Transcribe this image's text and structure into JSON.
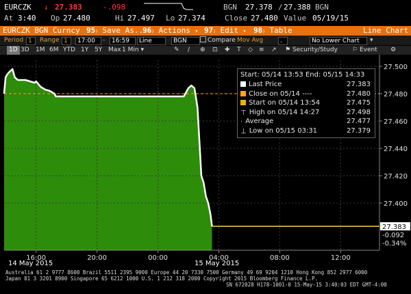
{
  "quote": {
    "ticker": "EURCZK",
    "arrow": "↓",
    "last": "27.383",
    "change": "-.098",
    "bid_label": "BGN",
    "bid": "27.378",
    "ask": "27.388",
    "ask_label": "BGN",
    "time_label": "At",
    "time": "3:40",
    "open_label": "Op",
    "open": "27.480",
    "high_label": "Hi",
    "high": "27.497",
    "low_label": "Lo",
    "low": "27.374",
    "close_label": "Close",
    "close": "27.480",
    "value_label": "Value",
    "value_date": "05/19/15"
  },
  "menu": {
    "security": "EURCZK BGN Curncy",
    "save_num": "95",
    "save": "Save As...",
    "actions_num": "96",
    "actions": "Actions",
    "edit_num": "97",
    "edit": "Edit",
    "table_num": "98",
    "table": "Table",
    "chart_title": "Line Chart"
  },
  "toolbar": {
    "period_label": "Period",
    "period_value": "1",
    "range_label": "Range",
    "range_value": "1",
    "start_time": "17:00",
    "end_time": "16:59",
    "line_select": "Line",
    "source": "BGN",
    "compare": "Compare",
    "mov_avg": "Mov Avg",
    "lower_chart": "No Lower Chart"
  },
  "ranges": {
    "items": [
      "1D",
      "3D",
      "1M",
      "6M",
      "YTD",
      "1Y",
      "5Y",
      "Max"
    ],
    "selected": "1D",
    "interval": "1 Min",
    "security_study": "Security/Study",
    "event": "Event"
  },
  "legend": {
    "header": "Start: 05/14 13:53 End: 05/15 14:33",
    "rows": [
      {
        "label": "Last Price",
        "value": "27.383",
        "marker": "white-box"
      },
      {
        "label": "Close on 05/14 ----",
        "value": "27.480",
        "marker": "orange-box"
      },
      {
        "label": "Start on 05/14 13:54",
        "value": "27.475",
        "marker": "gold-box"
      },
      {
        "label": "High on 05/14 14:27",
        "value": "27.498",
        "marker": "high-marker"
      },
      {
        "label": "Average",
        "value": "27.477",
        "marker": "average-marker"
      },
      {
        "label": "Low on 05/15 03:31",
        "value": "27.379",
        "marker": "low-marker"
      }
    ]
  },
  "last_tag": {
    "price": "27.383",
    "change": "-0.092",
    "pct": "-0.34%"
  },
  "date_labels": [
    "14 May 2015",
    "15 May 2015"
  ],
  "footer": {
    "line1": "Australia 61 2 9777 8600 Brazil 5511 2395 9000 Europe 44 20 7330 7500 Germany 49 69 9204 1210 Hong Kong 852 2977 6000",
    "line2": "Japan 81 3 3201 8900        Singapore 65 6212 1000        U.S. 1 212 318 2000        Copyright 2015 Bloomberg Finance L.P.",
    "line3": "SN 672028 H178-1001-0 15-May-15  3:40:03 EDT  GMT-4:00"
  },
  "colors": {
    "area_fill": "#2e8c0b",
    "line": "#ffffff",
    "close_line": "#ffa31a",
    "last_line": "#ffd24d",
    "menu_bar": "#e8700f",
    "down": "#ff3b3b"
  },
  "chart_data": {
    "type": "area",
    "title": "",
    "xlabel": "",
    "ylabel": "",
    "ylim": [
      27.38,
      27.5
    ],
    "y_ticks": [
      "27.500",
      "27.480",
      "27.460",
      "27.440",
      "27.420",
      "27.400"
    ],
    "x_ticks": [
      "16:00",
      "20:00",
      "00:00",
      "04:00",
      "08:00",
      "12:00"
    ],
    "x_tick_hours": [
      16,
      20,
      24,
      28,
      32,
      36
    ],
    "x_range_hours": [
      13.9,
      38.55
    ],
    "grid": true,
    "series": [
      {
        "name": "Last Price",
        "points": [
          [
            13.9,
            27.48
          ],
          [
            14.0,
            27.492
          ],
          [
            14.1,
            27.494
          ],
          [
            14.25,
            27.496
          ],
          [
            14.45,
            27.498
          ],
          [
            14.6,
            27.492
          ],
          [
            14.8,
            27.49
          ],
          [
            15.0,
            27.49
          ],
          [
            15.3,
            27.49
          ],
          [
            15.6,
            27.489
          ],
          [
            15.9,
            27.488
          ],
          [
            16.0,
            27.489
          ],
          [
            16.3,
            27.485
          ],
          [
            16.6,
            27.483
          ],
          [
            16.9,
            27.482
          ],
          [
            17.2,
            27.48
          ],
          [
            17.3,
            27.478
          ],
          [
            18.0,
            27.478
          ],
          [
            19.0,
            27.478
          ],
          [
            20.0,
            27.478
          ],
          [
            21.0,
            27.478
          ],
          [
            22.0,
            27.478
          ],
          [
            23.0,
            27.478
          ],
          [
            24.0,
            27.478
          ],
          [
            25.0,
            27.478
          ],
          [
            25.7,
            27.478
          ],
          [
            26.0,
            27.484
          ],
          [
            26.2,
            27.486
          ],
          [
            26.4,
            27.484
          ],
          [
            26.6,
            27.47
          ],
          [
            26.75,
            27.44
          ],
          [
            26.85,
            27.42
          ],
          [
            27.0,
            27.415
          ],
          [
            27.15,
            27.405
          ],
          [
            27.3,
            27.4
          ],
          [
            27.45,
            27.392
          ],
          [
            27.55,
            27.383
          ]
        ]
      }
    ],
    "reference_lines": [
      {
        "name": "Close on 05/14",
        "y": 27.48
      },
      {
        "name": "Last Price",
        "y": 27.383
      }
    ]
  }
}
